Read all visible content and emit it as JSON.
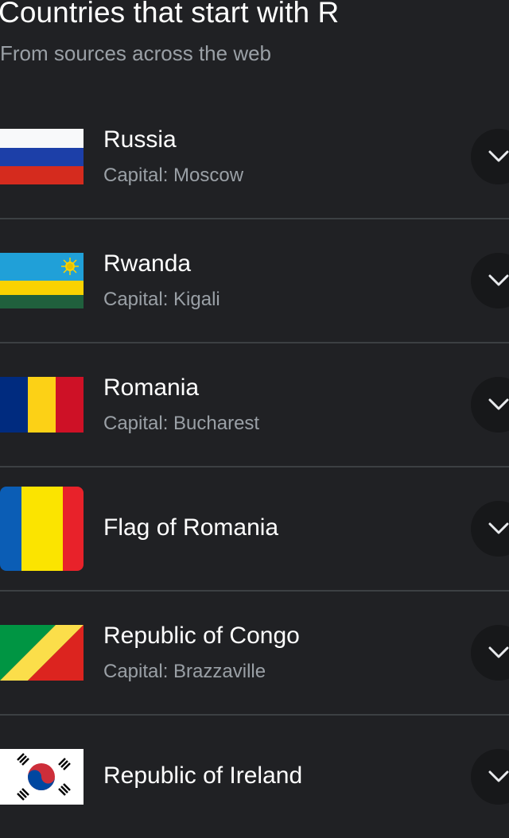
{
  "header": {
    "title": "Countries that start with R",
    "subtitle": "From sources across the web"
  },
  "items": [
    {
      "name": "Russia",
      "capital": "Capital: Moscow",
      "flag": "russia-flag",
      "expand_icon": "chevron-down-icon"
    },
    {
      "name": "Rwanda",
      "capital": "Capital: Kigali",
      "flag": "rwanda-flag",
      "expand_icon": "chevron-down-icon"
    },
    {
      "name": "Romania",
      "capital": "Capital: Bucharest",
      "flag": "romania-flag",
      "expand_icon": "chevron-down-icon"
    },
    {
      "name": "Flag of Romania",
      "capital": "",
      "flag": "romania-flag-rounded",
      "expand_icon": "chevron-down-icon"
    },
    {
      "name": "Republic of Congo",
      "capital": "Capital: Brazzaville",
      "flag": "congo-flag",
      "expand_icon": "chevron-down-icon"
    },
    {
      "name": "Republic of Ireland",
      "capital": "",
      "flag": "south-korea-flag",
      "expand_icon": "chevron-down-icon"
    }
  ],
  "colors": {
    "background": "#202124",
    "divider": "#3c4043",
    "primary_text": "#ffffff",
    "secondary_text": "#9aa0a6",
    "expand_button": "#17181a"
  }
}
